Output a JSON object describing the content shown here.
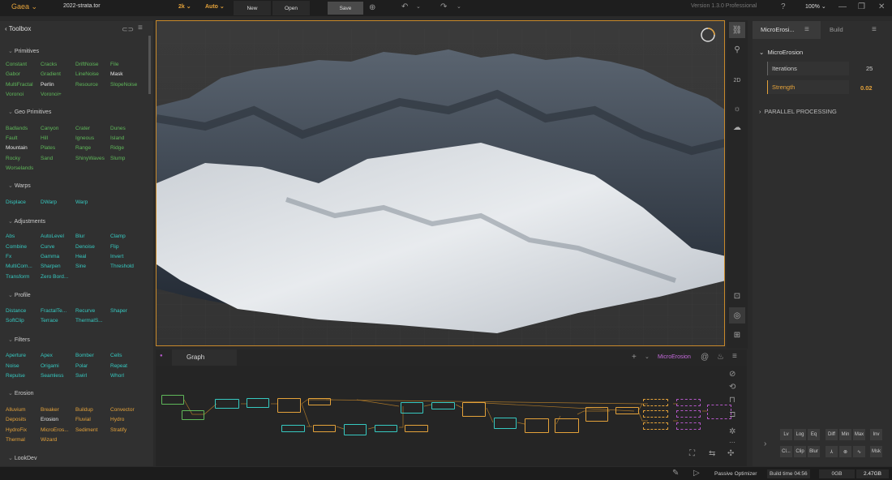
{
  "topbar": {
    "app_name": "Gaea",
    "file_name": "2022-strata.tor",
    "resolution": "2k",
    "mode": "Auto",
    "new_label": "New",
    "open_label": "Open",
    "save_label": "Save",
    "version": "Version 1.3.0 Professional",
    "zoom": "100%"
  },
  "toolbox": {
    "title": "Toolbox",
    "categories": [
      {
        "name": "Primitives"
      },
      {
        "name": "Geo Primitives"
      },
      {
        "name": "Warps"
      },
      {
        "name": "Adjustments"
      },
      {
        "name": "Profile"
      },
      {
        "name": "Filters"
      },
      {
        "name": "Erosion"
      },
      {
        "name": "LookDev"
      }
    ],
    "nodes": [
      [
        "Constant",
        "Cracks",
        "DriftNoise",
        "File"
      ],
      [
        "Gabor",
        "Gradient",
        "LineNoise",
        "Mask"
      ],
      [
        "MultiFractal",
        "Perlin",
        "Resource",
        "SlopeNoise"
      ],
      [
        "Voronoi",
        "Voronoi+"
      ],
      [
        "Badlands",
        "Canyon",
        "Crater",
        "Dunes"
      ],
      [
        "Fault",
        "Hill",
        "Igneous",
        "Island"
      ],
      [
        "Mountain",
        "Plates",
        "Range",
        "Ridge"
      ],
      [
        "Rocky",
        "Sand",
        "ShinyWaves",
        "Slump"
      ],
      [
        "Worselands"
      ],
      [
        "Displace",
        "DWarp",
        "Warp"
      ],
      [
        "Abs",
        "AutoLevel",
        "Blur",
        "Clamp"
      ],
      [
        "Combine",
        "Curve",
        "Denoise",
        "Flip"
      ],
      [
        "Fx",
        "Gamma",
        "Heal",
        "Invert"
      ],
      [
        "MultiCom...",
        "Sharpen",
        "Sine",
        "Threshold"
      ],
      [
        "Transform",
        "Zero Bord..."
      ],
      [
        "Distance",
        "FractalTe...",
        "Recurve",
        "Shaper"
      ],
      [
        "SoftClip",
        "Terrace",
        "ThermalS..."
      ],
      [
        "Aperture",
        "Apex",
        "Bomber",
        "Cells"
      ],
      [
        "Noise",
        "Origami",
        "Polar",
        "Repeat"
      ],
      [
        "Repulse",
        "Seamless",
        "Swirl",
        "Whorl"
      ],
      [
        "Alluvium",
        "Breaker",
        "Buildup",
        "Convector"
      ],
      [
        "Deposits",
        "Erosion",
        "Fluvial",
        "Hydro"
      ],
      [
        "HydroFix",
        "MicroEros...",
        "Sediment",
        "Stratify"
      ],
      [
        "Thermal",
        "Wizard"
      ]
    ]
  },
  "viewport": {
    "mode_2d": "2D"
  },
  "graph": {
    "tab": "Graph",
    "active_node": "MicroErosion"
  },
  "props": {
    "tab1": "MicroErosi...",
    "tab2": "Build",
    "section": "MicroErosion",
    "iterations_label": "Iterations",
    "iterations_value": "25",
    "strength_label": "Strength",
    "strength_value": "0.02",
    "parallel": "PARALLEL PROCESSING",
    "buttons_row1": [
      "Lv",
      "Log",
      "Eq",
      "Diff",
      "Min",
      "Max",
      "Inv"
    ],
    "buttons_row2": [
      "Cl...",
      "Clip",
      "Blur",
      "⅄",
      "⊗",
      "∿",
      "Msk"
    ]
  },
  "status": {
    "optimizer": "Passive Optimizer",
    "build_time": "Build time 04:56",
    "mem1": "0GB",
    "mem2": "2.47GB"
  },
  "colors": {
    "accent": "#e4a23a",
    "teal": "#36c9c1",
    "green": "#5fb85a",
    "purple": "#b558c9"
  }
}
